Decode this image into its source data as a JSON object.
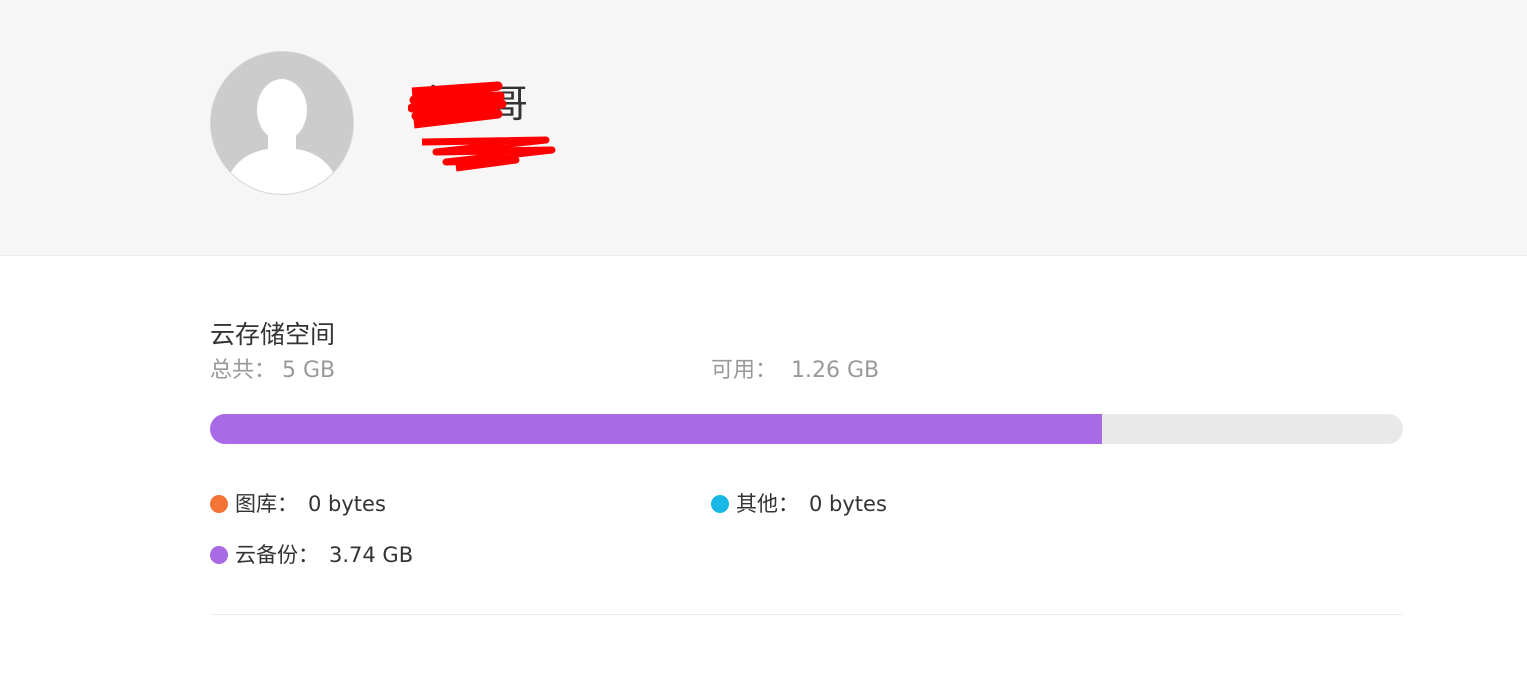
{
  "profile": {
    "name": "大帅哥",
    "avatar_icon": "default-user-avatar-icon"
  },
  "storage": {
    "title": "云存储空间",
    "total_label": "总共：",
    "total_value": "5 GB",
    "available_label": "可用：",
    "available_value": "1.26 GB",
    "used_fraction": 0.748,
    "bar_color": "#a96ae6",
    "legend": [
      {
        "label": "图库：",
        "value": "0 bytes",
        "color": "#f37436"
      },
      {
        "label": "其他：",
        "value": "0 bytes",
        "color": "#1bb7e4"
      },
      {
        "label": "云备份：",
        "value": "3.74 GB",
        "color": "#a96ae6"
      }
    ]
  }
}
